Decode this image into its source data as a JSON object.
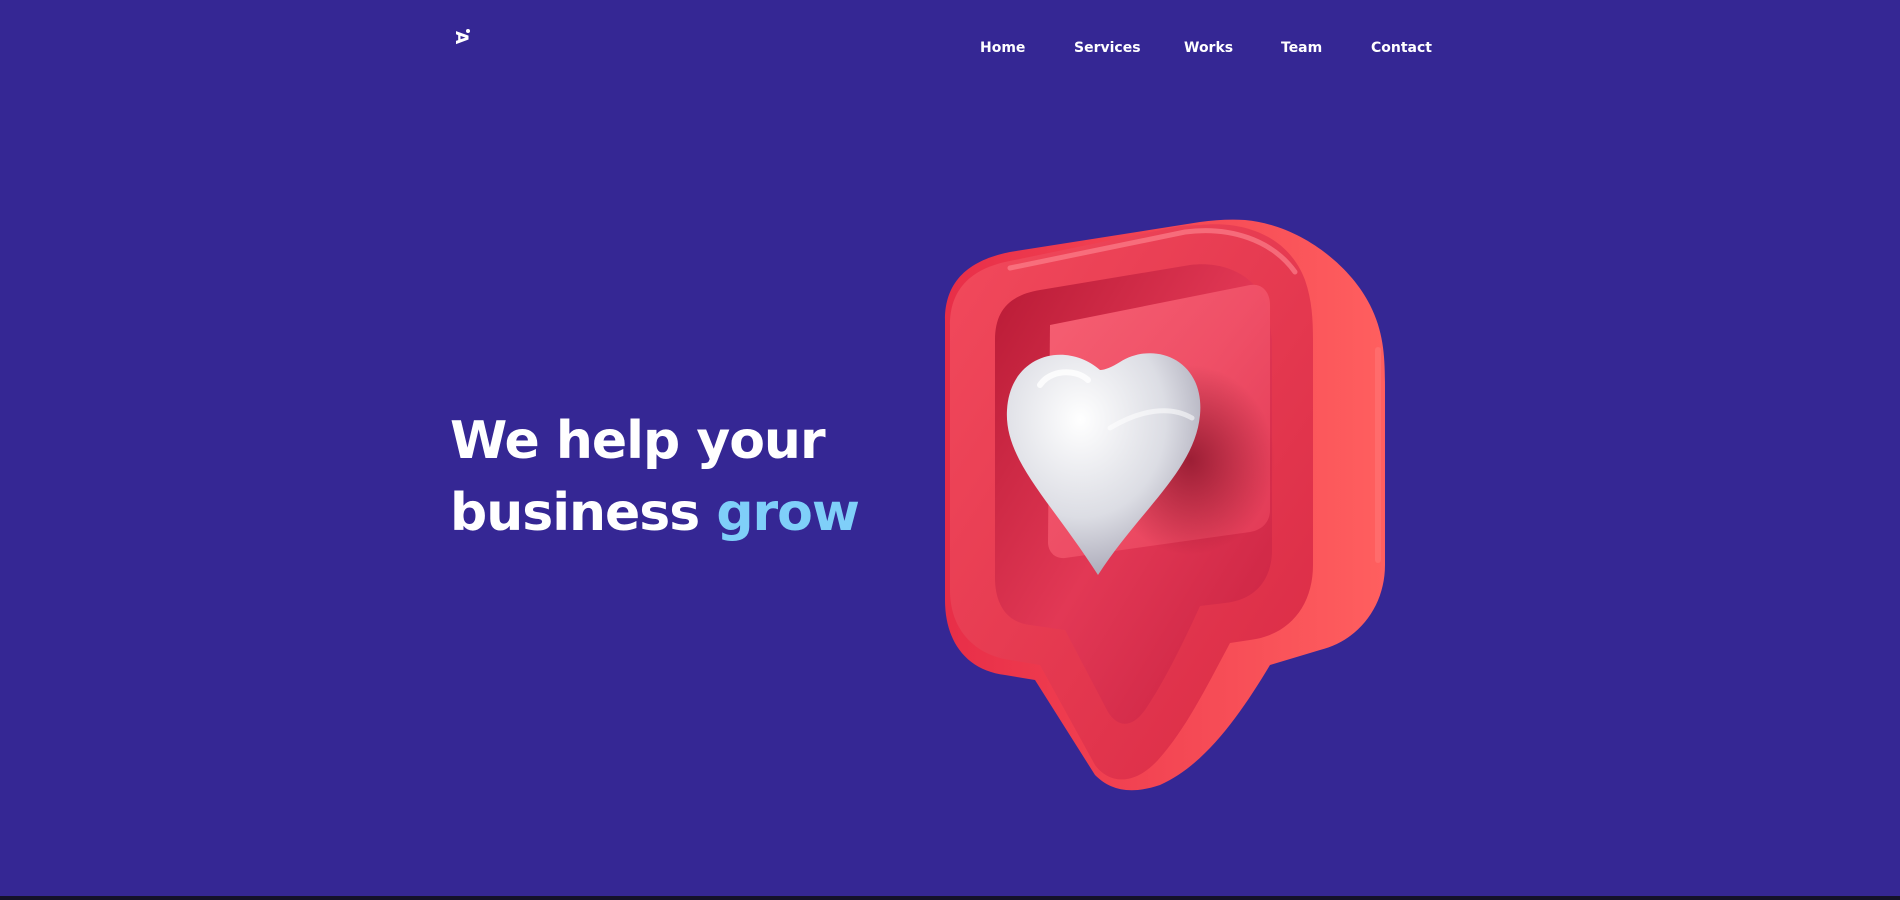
{
  "logo": {
    "letter": "A",
    "name": "logo-icon"
  },
  "nav": {
    "home": "Home",
    "services": "Services",
    "works": "Works",
    "team": "Team",
    "contact": "Contact"
  },
  "hero": {
    "line1": "We help your",
    "line2_prefix": "business ",
    "line2_accent": "grow",
    "illustration_icon": "heart-speech-bubble-icon"
  },
  "colors": {
    "background": "#352794",
    "text": "#ffffff",
    "accent": "#7fcff9",
    "bubble_red": "#f0404f",
    "heart_white": "#e8e8ee"
  }
}
